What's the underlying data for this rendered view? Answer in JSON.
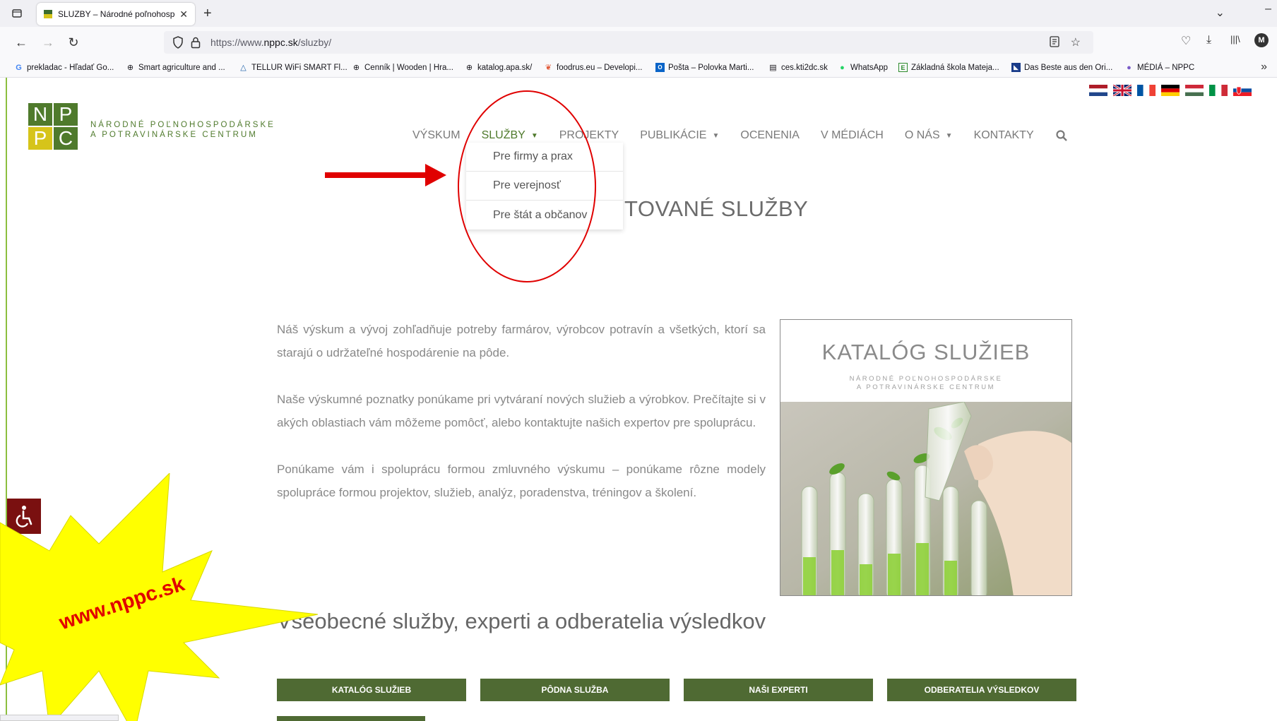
{
  "browser": {
    "tab_title": "SLUZBY – Národné poľnohospo",
    "url_prefix": "https://www.",
    "url_host": "nppc.sk",
    "url_path": "/sluzby/",
    "bookmarks": [
      "prekladac - Hľadať Go...",
      "Smart agriculture and ...",
      "TELLUR WiFi SMART Fl...",
      "Cenník | Wooden | Hra...",
      "katalog.apa.sk/",
      "foodrus.eu – Developi...",
      "Pošta – Polovka Marti...",
      "ces.kti2dc.sk",
      "WhatsApp",
      "Základná škola Mateja...",
      "Das Beste aus den Ori...",
      "MÉDIÁ – NPPC"
    ]
  },
  "logo": {
    "letters": [
      "N",
      "P",
      "P",
      "C"
    ],
    "line1": "NÁRODNÉ POĽNOHOSPODÁRSKE",
    "line2": "A POTRAVINÁRSKE CENTRUM"
  },
  "nav": {
    "items": [
      "VÝSKUM",
      "SLUŽBY",
      "PROJEKTY",
      "PUBLIKÁCIE",
      "OCENENIA",
      "V MÉDIÁCH",
      "O NÁS",
      "KONTAKTY"
    ]
  },
  "dropdown": {
    "items": [
      "Pre firmy a prax",
      "Pre verejnosť",
      "Pre štát a občanov"
    ]
  },
  "heading_partial": "TOVANÉ SLUŽBY",
  "content": {
    "p1": "Náš výskum a vývoj zohľadňuje potreby farmárov, výrobcov potravín a všetkých, ktorí sa starajú o udržateľné hospodárenie na pôde.",
    "p2": "Naše výskumné poznatky ponúkame pri vytváraní nových služieb a výrobkov. Prečítajte si v akých oblastiach vám môžeme pomôcť, alebo kontaktujte našich expertov pre spoluprácu.",
    "p3": "Ponúkame vám i spoluprácu formou zmluvného výskumu – ponúkame rôzne modely spolupráce formou projektov, služieb, analýz, poradenstva, tréningov a školení."
  },
  "catalog": {
    "title": "KATALÓG SLUŽIEB",
    "sub1": "NÁRODNÉ POĽNOHOSPODÁRSKE",
    "sub2": "A POTRAVINÁRSKE CENTRUM"
  },
  "section_title": "Všeobecné služby, experti a odberatelia výsledkov",
  "buttons": [
    "KATALÓG SLUŽIEB",
    "PÔDNA SLUŽBA",
    "NAŠI EXPERTI",
    "ODBERATELIA VÝSLEDKOV"
  ],
  "starburst_text": "www.nppc.sk",
  "colors": {
    "brand_green": "#4f7a2c",
    "brand_yellow": "#d6c41a",
    "button_green": "#4f6a33",
    "annotation_red": "#e00000",
    "starburst_yellow": "#ffff00"
  }
}
